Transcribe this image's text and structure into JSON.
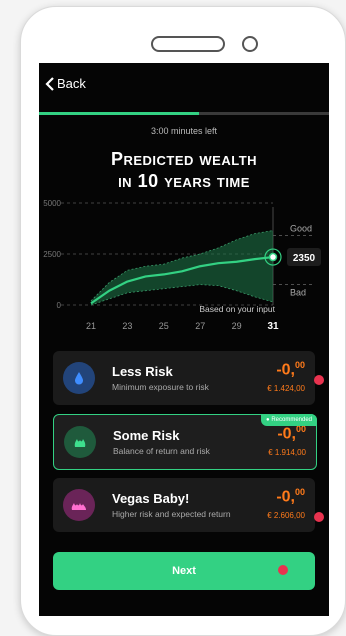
{
  "header": {
    "back_label": "Back",
    "time_left": "3:00 minutes left",
    "progress": 0.55
  },
  "title": {
    "line1": "Predicted wealth",
    "line2": "in 10 years time"
  },
  "chart_data": {
    "type": "area",
    "x": [
      21,
      22,
      23,
      24,
      25,
      26,
      27,
      28,
      29,
      30,
      31
    ],
    "series": [
      {
        "name": "Based on your input",
        "values": [
          80,
          700,
          1150,
          1400,
          1500,
          1650,
          1900,
          2050,
          2120,
          2250,
          2350
        ]
      }
    ],
    "band_low": [
      0,
      300,
      600,
      700,
      800,
      900,
      1000,
      950,
      700,
      400,
      150
    ],
    "band_high": [
      200,
      1100,
      1700,
      1900,
      2000,
      2300,
      2500,
      2800,
      3200,
      3500,
      3650
    ],
    "xticks": [
      21,
      23,
      25,
      27,
      29,
      31
    ],
    "yticks": [
      0,
      2500,
      5000
    ],
    "ylim": [
      0,
      5000
    ],
    "end_value": "2350",
    "good_label": "Good",
    "bad_label": "Bad",
    "annotation": "Based on your input",
    "colors": {
      "line": "#33d183",
      "band": "#1f7a4a"
    }
  },
  "options": [
    {
      "title": "Less Risk",
      "subtitle": "Minimum exposure to risk",
      "value_main": "-0,",
      "value_cents": "00",
      "amount": "€ 1.424,00",
      "icon": "drop-icon",
      "icon_bg": "#22447a",
      "icon_fg": "#3f8dff"
    },
    {
      "title": "Some Risk",
      "subtitle": "Balance of return and risk",
      "value_main": "-0,",
      "value_cents": "00",
      "amount": "€ 1.914,00",
      "icon": "flame-icon",
      "icon_bg": "#1f5a3c",
      "icon_fg": "#3ee08e",
      "badge": "Recommended"
    },
    {
      "title": "Vegas Baby!",
      "subtitle": "Higher risk and expected return",
      "value_main": "-0,",
      "value_cents": "00",
      "amount": "€ 2.606,00",
      "icon": "fire-icon",
      "icon_bg": "#6a2458",
      "icon_fg": "#ff6fd0"
    }
  ],
  "next_label": "Next"
}
